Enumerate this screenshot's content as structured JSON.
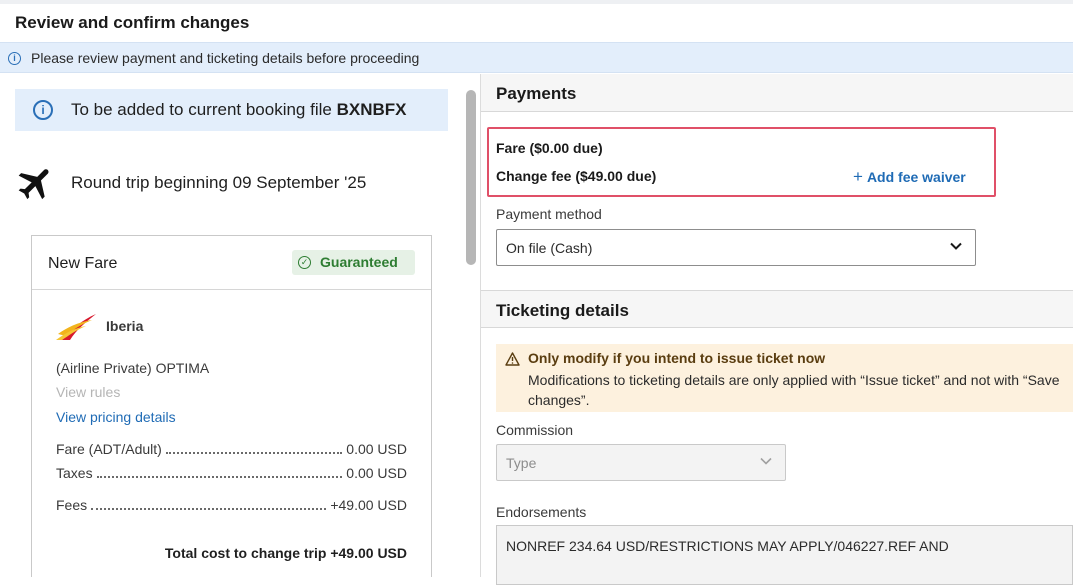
{
  "header": {
    "title": "Review and confirm changes"
  },
  "banner": {
    "text": "Please review payment and ticketing details before proceeding",
    "icon": "info-icon"
  },
  "booking": {
    "prefix": "To be added to current booking file ",
    "code": "BXNBFX"
  },
  "trip": {
    "text": "Round trip beginning 09 September '25",
    "icon": "plane-icon"
  },
  "fare_card": {
    "title": "New Fare",
    "badge": "Guaranteed",
    "airline": "Iberia",
    "brand": "(Airline Private) OPTIMA",
    "view_rules": "View rules",
    "pricing_link": "View pricing details",
    "lines": [
      {
        "label": "Fare (ADT/Adult)",
        "amount": "0.00 USD"
      },
      {
        "label": "Taxes",
        "amount": "0.00 USD"
      },
      {
        "label": "Fees",
        "amount": "+49.00 USD"
      }
    ],
    "total": "Total cost to change trip +49.00 USD"
  },
  "payments": {
    "title": "Payments",
    "fare_due": "Fare ($0.00 due)",
    "change_fee": "Change fee ($49.00 due)",
    "add_fee_waiver": "Add fee waiver",
    "method_label": "Payment method",
    "method_value": "On file (Cash)"
  },
  "ticketing": {
    "title": "Ticketing details",
    "warning_title": "Only modify if you intend to issue ticket now",
    "warning_text": "Modifications to ticketing details are only applied with “Issue ticket” and not with “Save changes”.",
    "commission_label": "Commission",
    "commission_placeholder": "Type",
    "endorsements_label": "Endorsements",
    "endorsements_value": "NONREF 234.64 USD/RESTRICTIONS MAY APPLY/046227.REF AND"
  },
  "colors": {
    "accent": "#1f6bb5",
    "highlight_border": "#e05068",
    "guaranteed": "#2e7d32",
    "warning_bg": "#fdf1de"
  }
}
